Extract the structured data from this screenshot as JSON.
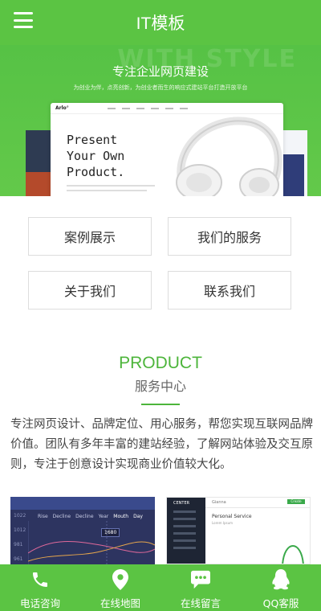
{
  "header": {
    "title": "IT模板",
    "menu_icon": "hamburger-menu-icon"
  },
  "banner": {
    "bg_text": "WITH STYLE",
    "heading": "专注企业网页建设",
    "subheading": "为创业为伴，点亮创新，为创业者而生的响应式建站平台打造开放平台",
    "mock": {
      "logo": "Arlo°",
      "headline_lines": [
        "Present",
        "Your Own",
        "Product."
      ]
    }
  },
  "links": [
    {
      "label": "案例展示"
    },
    {
      "label": "我们的服务"
    },
    {
      "label": "关于我们"
    },
    {
      "label": "联系我们"
    }
  ],
  "product": {
    "title": "PRODUCT",
    "subtitle": "服务中心",
    "description": "专注网页设计、品牌定位、用心服务，帮您实现互联网品牌价值。团队有多年丰富的建站经验，了解网站体验及交互原则，专注于创意设计实现商业价值较大化。"
  },
  "thumbs": [
    {
      "legend": [
        "Rise",
        "Decline",
        "Decline",
        "Year",
        "Mouth",
        "Day"
      ],
      "axis": [
        "1022",
        "1012",
        "981",
        "961"
      ],
      "tooltip": "1680"
    },
    {
      "logo": "CENTER",
      "title": "Gianna",
      "button": "Create Project",
      "heading": "Personal Service",
      "sub": "Lorem Ipsum"
    }
  ],
  "bottom_bar": [
    {
      "label": "电话咨询",
      "icon": "phone-icon"
    },
    {
      "label": "在线地图",
      "icon": "map-pin-icon"
    },
    {
      "label": "在线留言",
      "icon": "chat-bubble-icon"
    },
    {
      "label": "QQ客服",
      "icon": "qq-icon"
    }
  ],
  "colors": {
    "primary": "#5bc443",
    "accent_text": "#4db53b"
  }
}
